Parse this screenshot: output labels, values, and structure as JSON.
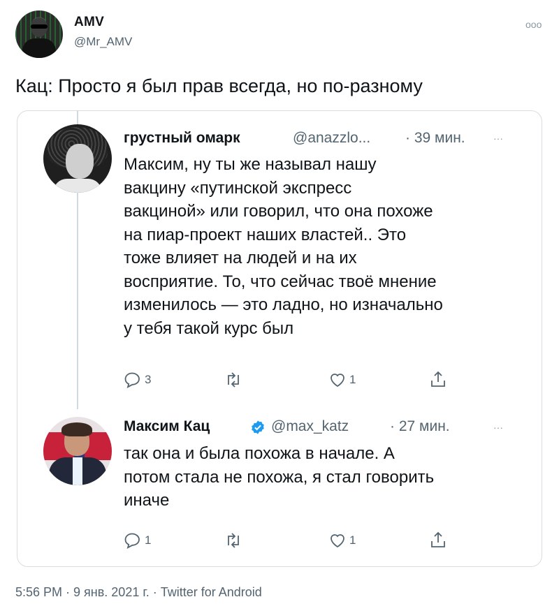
{
  "author": {
    "name": "AMV",
    "handle": "@Mr_AMV",
    "more": "ooo"
  },
  "tweet_text": "Кац: Просто я был прав всегда, но по-разному",
  "reply1": {
    "name": "грустный омарк",
    "handle": "@anazzlo...",
    "time": "· 39 мин.",
    "more": "···",
    "text_lines": [
      "Максим, ну ты же называл нашу",
      "вакцину «путинской экспресс",
      "вакциной» или говорил, что она похоже",
      "на пиар-проект наших властей.. Это",
      "тоже влияет на людей и на их",
      "восприятие. То, что сейчас твоё мнение",
      "изменилось — это ладно, но изначально",
      "у тебя такой курс был"
    ],
    "actions": {
      "replies": "3",
      "retweets": "",
      "likes": "1"
    }
  },
  "reply2": {
    "name": "Максим Кац",
    "verified": true,
    "handle": "@max_katz",
    "time": "· 27 мин.",
    "more": "···",
    "text_lines": [
      "так она и была похожа в начале. А",
      "потом стала не похожа, я стал говорить",
      "иначе"
    ],
    "actions": {
      "replies": "1",
      "retweets": "",
      "likes": "1"
    }
  },
  "footer": {
    "meta": "5:56 PM · 9 янв. 2021 г. · Twitter for Android"
  },
  "colors": {
    "text": "#0f1419",
    "muted": "#536471",
    "border": "#d9dde1",
    "verified": "#1d9bf0"
  },
  "icons": {
    "reply": "speech-bubble-icon",
    "retweet": "retweet-arrows-icon",
    "like": "heart-icon",
    "share": "share-upload-icon",
    "verified": "verified-badge-icon"
  }
}
